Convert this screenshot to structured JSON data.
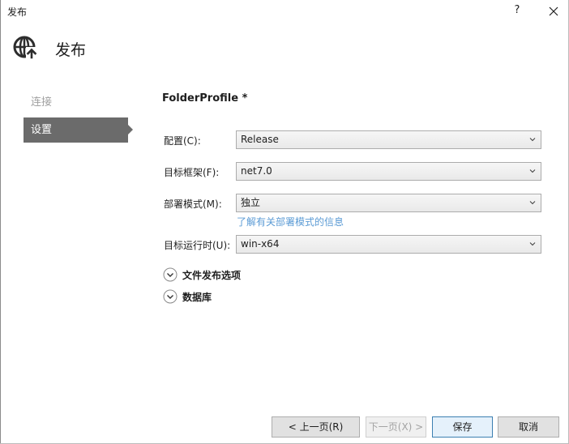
{
  "window": {
    "title": "发布",
    "help_label": "?"
  },
  "header": {
    "title": "发布"
  },
  "nav": {
    "items": [
      {
        "label": "连接"
      },
      {
        "label": "设置"
      }
    ]
  },
  "profile": {
    "title": "FolderProfile *"
  },
  "fields": {
    "configuration": {
      "label": "配置(C):",
      "value": "Release"
    },
    "target_framework": {
      "label": "目标框架(F):",
      "value": "net7.0"
    },
    "deployment_mode": {
      "label": "部署模式(M):",
      "value": "独立"
    },
    "target_runtime": {
      "label": "目标运行时(U):",
      "value": "win-x64"
    }
  },
  "links": {
    "learn_more": "了解有关部署模式的信息"
  },
  "expanders": {
    "file_publish_options": "文件发布选项",
    "databases": "数据库"
  },
  "buttons": {
    "previous": "< 上一页(R)",
    "next": "下一页(X) >",
    "save": "保存",
    "cancel": "取消"
  },
  "colors": {
    "nav_active_bg": "#6b6b6b",
    "link": "#5b9bd5",
    "primary_border": "#3c7fb1"
  }
}
